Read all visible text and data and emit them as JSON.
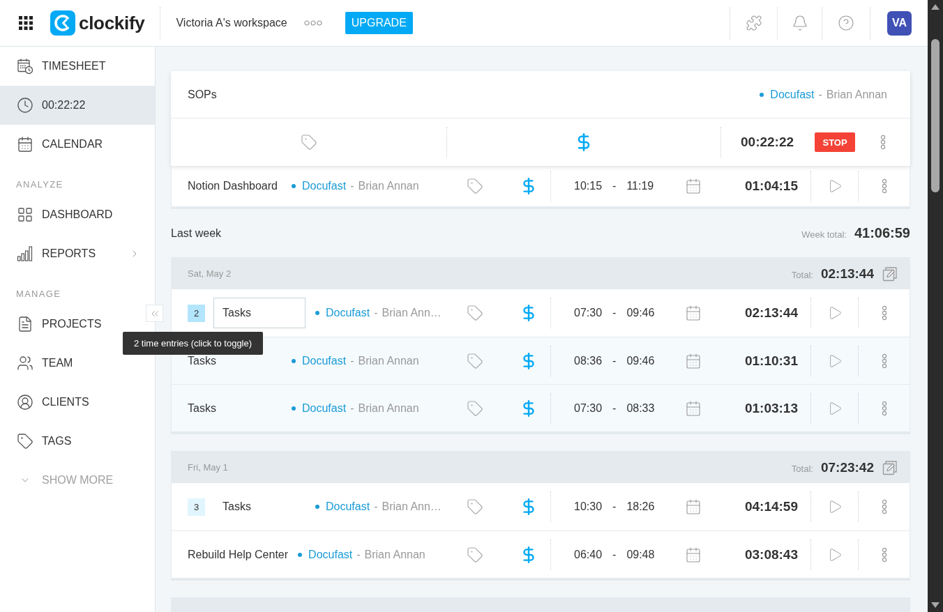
{
  "top_bar": {
    "logo_text": "clockify",
    "workspace": "Victoria A's workspace",
    "upgrade_button": "UPGRADE",
    "avatar": "VA"
  },
  "sidebar": {
    "sections": [
      {
        "items": [
          {
            "label": "TIMESHEET",
            "selected": false,
            "submenu": false
          },
          {
            "label": "00:22:22",
            "selected": true,
            "submenu": false
          },
          {
            "label": "CALENDAR",
            "selected": false,
            "submenu": false
          }
        ]
      },
      {
        "label": "ANALYZE",
        "items": [
          {
            "label": "DASHBOARD",
            "selected": false,
            "submenu": false
          },
          {
            "label": "REPORTS",
            "selected": false,
            "submenu": true
          }
        ]
      },
      {
        "label": "MANAGE",
        "items": [
          {
            "label": "PROJECTS",
            "selected": false,
            "submenu": false
          },
          {
            "label": "TEAM",
            "selected": false,
            "submenu": false
          },
          {
            "label": "CLIENTS",
            "selected": false,
            "submenu": false
          },
          {
            "label": "TAGS",
            "selected": false,
            "submenu": false
          }
        ]
      }
    ],
    "show_more": "SHOW MORE"
  },
  "tooltip": "2 time entries (click to toggle)",
  "timer": {
    "description": "SOPs",
    "project": "Docufast",
    "separator": "-",
    "client": "Brian Annan",
    "billable": true,
    "duration": "00:22:22",
    "stop_button": "STOP"
  },
  "recent_entries": [
    {
      "kind": "entry",
      "description": "Notion Dashboard",
      "project": "Docufast",
      "separator": "-",
      "client": "Brian Annan",
      "billable": true,
      "start": "10:15",
      "range_separator": "-",
      "end": "11:19",
      "duration": "01:04:15"
    }
  ],
  "last_week": {
    "title": "Last week",
    "total_label": "Week total:",
    "total": "41:06:59",
    "days": [
      {
        "date": "Sat, May 2",
        "total_label": "Total:",
        "total": "02:13:44",
        "entries": [
          {
            "kind": "group",
            "count": "2",
            "expanded": true,
            "hovered": true,
            "description": "Tasks",
            "project": "Docufast",
            "separator": "-",
            "client": "Brian Ann…",
            "billable": true,
            "start": "07:30",
            "range_separator": "-",
            "end": "09:46",
            "duration": "02:13:44"
          },
          {
            "kind": "child",
            "description": "Tasks",
            "project": "Docufast",
            "separator": "-",
            "client": "Brian Annan",
            "billable": true,
            "start": "08:36",
            "range_separator": "-",
            "end": "09:46",
            "duration": "01:10:31"
          },
          {
            "kind": "child",
            "description": "Tasks",
            "project": "Docufast",
            "separator": "-",
            "client": "Brian Annan",
            "billable": true,
            "start": "07:30",
            "range_separator": "-",
            "end": "08:33",
            "duration": "01:03:13"
          }
        ]
      },
      {
        "date": "Fri, May 1",
        "total_label": "Total:",
        "total": "07:23:42",
        "entries": [
          {
            "kind": "group",
            "count": "3",
            "expanded": false,
            "hovered": false,
            "description": "Tasks",
            "project": "Docufast",
            "separator": "-",
            "client": "Brian Ann…",
            "billable": true,
            "start": "10:30",
            "range_separator": "-",
            "end": "18:26",
            "duration": "04:14:59"
          },
          {
            "kind": "entry",
            "description": "Rebuild Help Center",
            "project": "Docufast",
            "separator": "-",
            "client": "Brian Annan",
            "billable": true,
            "start": "06:40",
            "range_separator": "-",
            "end": "09:48",
            "duration": "03:08:43"
          }
        ]
      }
    ]
  }
}
